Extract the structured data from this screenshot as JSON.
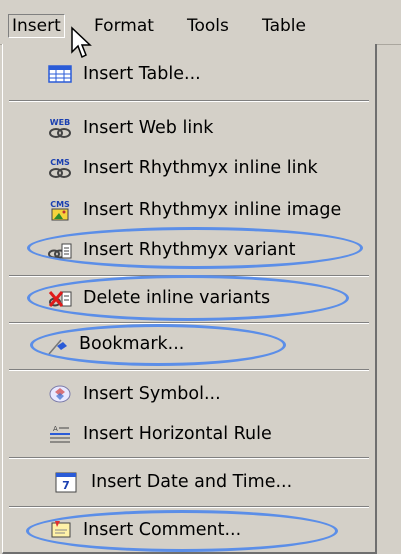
{
  "menubar": {
    "items": [
      "Insert",
      "Format",
      "Tools",
      "Table"
    ]
  },
  "menu": {
    "items": [
      {
        "label": "Insert Table...",
        "icon": "table-icon"
      },
      {
        "label": "Insert Web link",
        "icon": "web-link-icon",
        "icon_text": "WEB"
      },
      {
        "label": "Insert Rhythmyx inline link",
        "icon": "cms-link-icon",
        "icon_text": "CMS"
      },
      {
        "label": "Insert Rhythmyx inline image",
        "icon": "cms-image-icon",
        "icon_text": "CMS"
      },
      {
        "label": "Insert Rhythmyx variant",
        "icon": "variant-icon"
      },
      {
        "label": "Delete inline variants",
        "icon": "delete-variant-icon"
      },
      {
        "label": "Bookmark...",
        "icon": "bookmark-icon"
      },
      {
        "label": "Insert Symbol...",
        "icon": "symbol-icon"
      },
      {
        "label": "Insert Horizontal Rule",
        "icon": "horizontal-rule-icon"
      },
      {
        "label": "Insert Date and Time...",
        "icon": "calendar-icon",
        "icon_text": "7"
      },
      {
        "label": "Insert Comment...",
        "icon": "comment-icon"
      }
    ]
  },
  "highlight_color": "#5b8ee8"
}
